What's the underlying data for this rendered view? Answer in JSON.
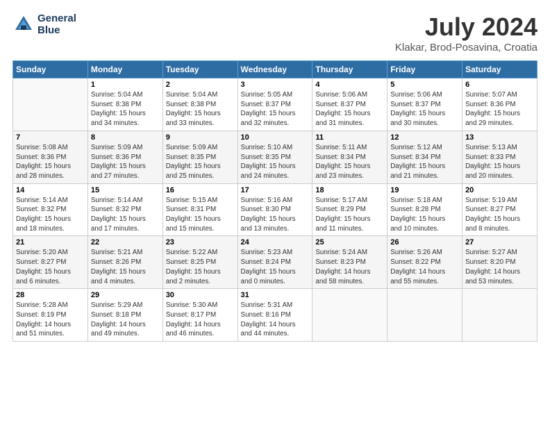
{
  "header": {
    "logo_line1": "General",
    "logo_line2": "Blue",
    "title": "July 2024",
    "subtitle": "Klakar, Brod-Posavina, Croatia"
  },
  "columns": [
    "Sunday",
    "Monday",
    "Tuesday",
    "Wednesday",
    "Thursday",
    "Friday",
    "Saturday"
  ],
  "weeks": [
    [
      {
        "day": "",
        "info": ""
      },
      {
        "day": "1",
        "info": "Sunrise: 5:04 AM\nSunset: 8:38 PM\nDaylight: 15 hours\nand 34 minutes."
      },
      {
        "day": "2",
        "info": "Sunrise: 5:04 AM\nSunset: 8:38 PM\nDaylight: 15 hours\nand 33 minutes."
      },
      {
        "day": "3",
        "info": "Sunrise: 5:05 AM\nSunset: 8:37 PM\nDaylight: 15 hours\nand 32 minutes."
      },
      {
        "day": "4",
        "info": "Sunrise: 5:06 AM\nSunset: 8:37 PM\nDaylight: 15 hours\nand 31 minutes."
      },
      {
        "day": "5",
        "info": "Sunrise: 5:06 AM\nSunset: 8:37 PM\nDaylight: 15 hours\nand 30 minutes."
      },
      {
        "day": "6",
        "info": "Sunrise: 5:07 AM\nSunset: 8:36 PM\nDaylight: 15 hours\nand 29 minutes."
      }
    ],
    [
      {
        "day": "7",
        "info": "Sunrise: 5:08 AM\nSunset: 8:36 PM\nDaylight: 15 hours\nand 28 minutes."
      },
      {
        "day": "8",
        "info": "Sunrise: 5:09 AM\nSunset: 8:36 PM\nDaylight: 15 hours\nand 27 minutes."
      },
      {
        "day": "9",
        "info": "Sunrise: 5:09 AM\nSunset: 8:35 PM\nDaylight: 15 hours\nand 25 minutes."
      },
      {
        "day": "10",
        "info": "Sunrise: 5:10 AM\nSunset: 8:35 PM\nDaylight: 15 hours\nand 24 minutes."
      },
      {
        "day": "11",
        "info": "Sunrise: 5:11 AM\nSunset: 8:34 PM\nDaylight: 15 hours\nand 23 minutes."
      },
      {
        "day": "12",
        "info": "Sunrise: 5:12 AM\nSunset: 8:34 PM\nDaylight: 15 hours\nand 21 minutes."
      },
      {
        "day": "13",
        "info": "Sunrise: 5:13 AM\nSunset: 8:33 PM\nDaylight: 15 hours\nand 20 minutes."
      }
    ],
    [
      {
        "day": "14",
        "info": "Sunrise: 5:14 AM\nSunset: 8:32 PM\nDaylight: 15 hours\nand 18 minutes."
      },
      {
        "day": "15",
        "info": "Sunrise: 5:14 AM\nSunset: 8:32 PM\nDaylight: 15 hours\nand 17 minutes."
      },
      {
        "day": "16",
        "info": "Sunrise: 5:15 AM\nSunset: 8:31 PM\nDaylight: 15 hours\nand 15 minutes."
      },
      {
        "day": "17",
        "info": "Sunrise: 5:16 AM\nSunset: 8:30 PM\nDaylight: 15 hours\nand 13 minutes."
      },
      {
        "day": "18",
        "info": "Sunrise: 5:17 AM\nSunset: 8:29 PM\nDaylight: 15 hours\nand 11 minutes."
      },
      {
        "day": "19",
        "info": "Sunrise: 5:18 AM\nSunset: 8:28 PM\nDaylight: 15 hours\nand 10 minutes."
      },
      {
        "day": "20",
        "info": "Sunrise: 5:19 AM\nSunset: 8:27 PM\nDaylight: 15 hours\nand 8 minutes."
      }
    ],
    [
      {
        "day": "21",
        "info": "Sunrise: 5:20 AM\nSunset: 8:27 PM\nDaylight: 15 hours\nand 6 minutes."
      },
      {
        "day": "22",
        "info": "Sunrise: 5:21 AM\nSunset: 8:26 PM\nDaylight: 15 hours\nand 4 minutes."
      },
      {
        "day": "23",
        "info": "Sunrise: 5:22 AM\nSunset: 8:25 PM\nDaylight: 15 hours\nand 2 minutes."
      },
      {
        "day": "24",
        "info": "Sunrise: 5:23 AM\nSunset: 8:24 PM\nDaylight: 15 hours\nand 0 minutes."
      },
      {
        "day": "25",
        "info": "Sunrise: 5:24 AM\nSunset: 8:23 PM\nDaylight: 14 hours\nand 58 minutes."
      },
      {
        "day": "26",
        "info": "Sunrise: 5:26 AM\nSunset: 8:22 PM\nDaylight: 14 hours\nand 55 minutes."
      },
      {
        "day": "27",
        "info": "Sunrise: 5:27 AM\nSunset: 8:20 PM\nDaylight: 14 hours\nand 53 minutes."
      }
    ],
    [
      {
        "day": "28",
        "info": "Sunrise: 5:28 AM\nSunset: 8:19 PM\nDaylight: 14 hours\nand 51 minutes."
      },
      {
        "day": "29",
        "info": "Sunrise: 5:29 AM\nSunset: 8:18 PM\nDaylight: 14 hours\nand 49 minutes."
      },
      {
        "day": "30",
        "info": "Sunrise: 5:30 AM\nSunset: 8:17 PM\nDaylight: 14 hours\nand 46 minutes."
      },
      {
        "day": "31",
        "info": "Sunrise: 5:31 AM\nSunset: 8:16 PM\nDaylight: 14 hours\nand 44 minutes."
      },
      {
        "day": "",
        "info": ""
      },
      {
        "day": "",
        "info": ""
      },
      {
        "day": "",
        "info": ""
      }
    ]
  ]
}
